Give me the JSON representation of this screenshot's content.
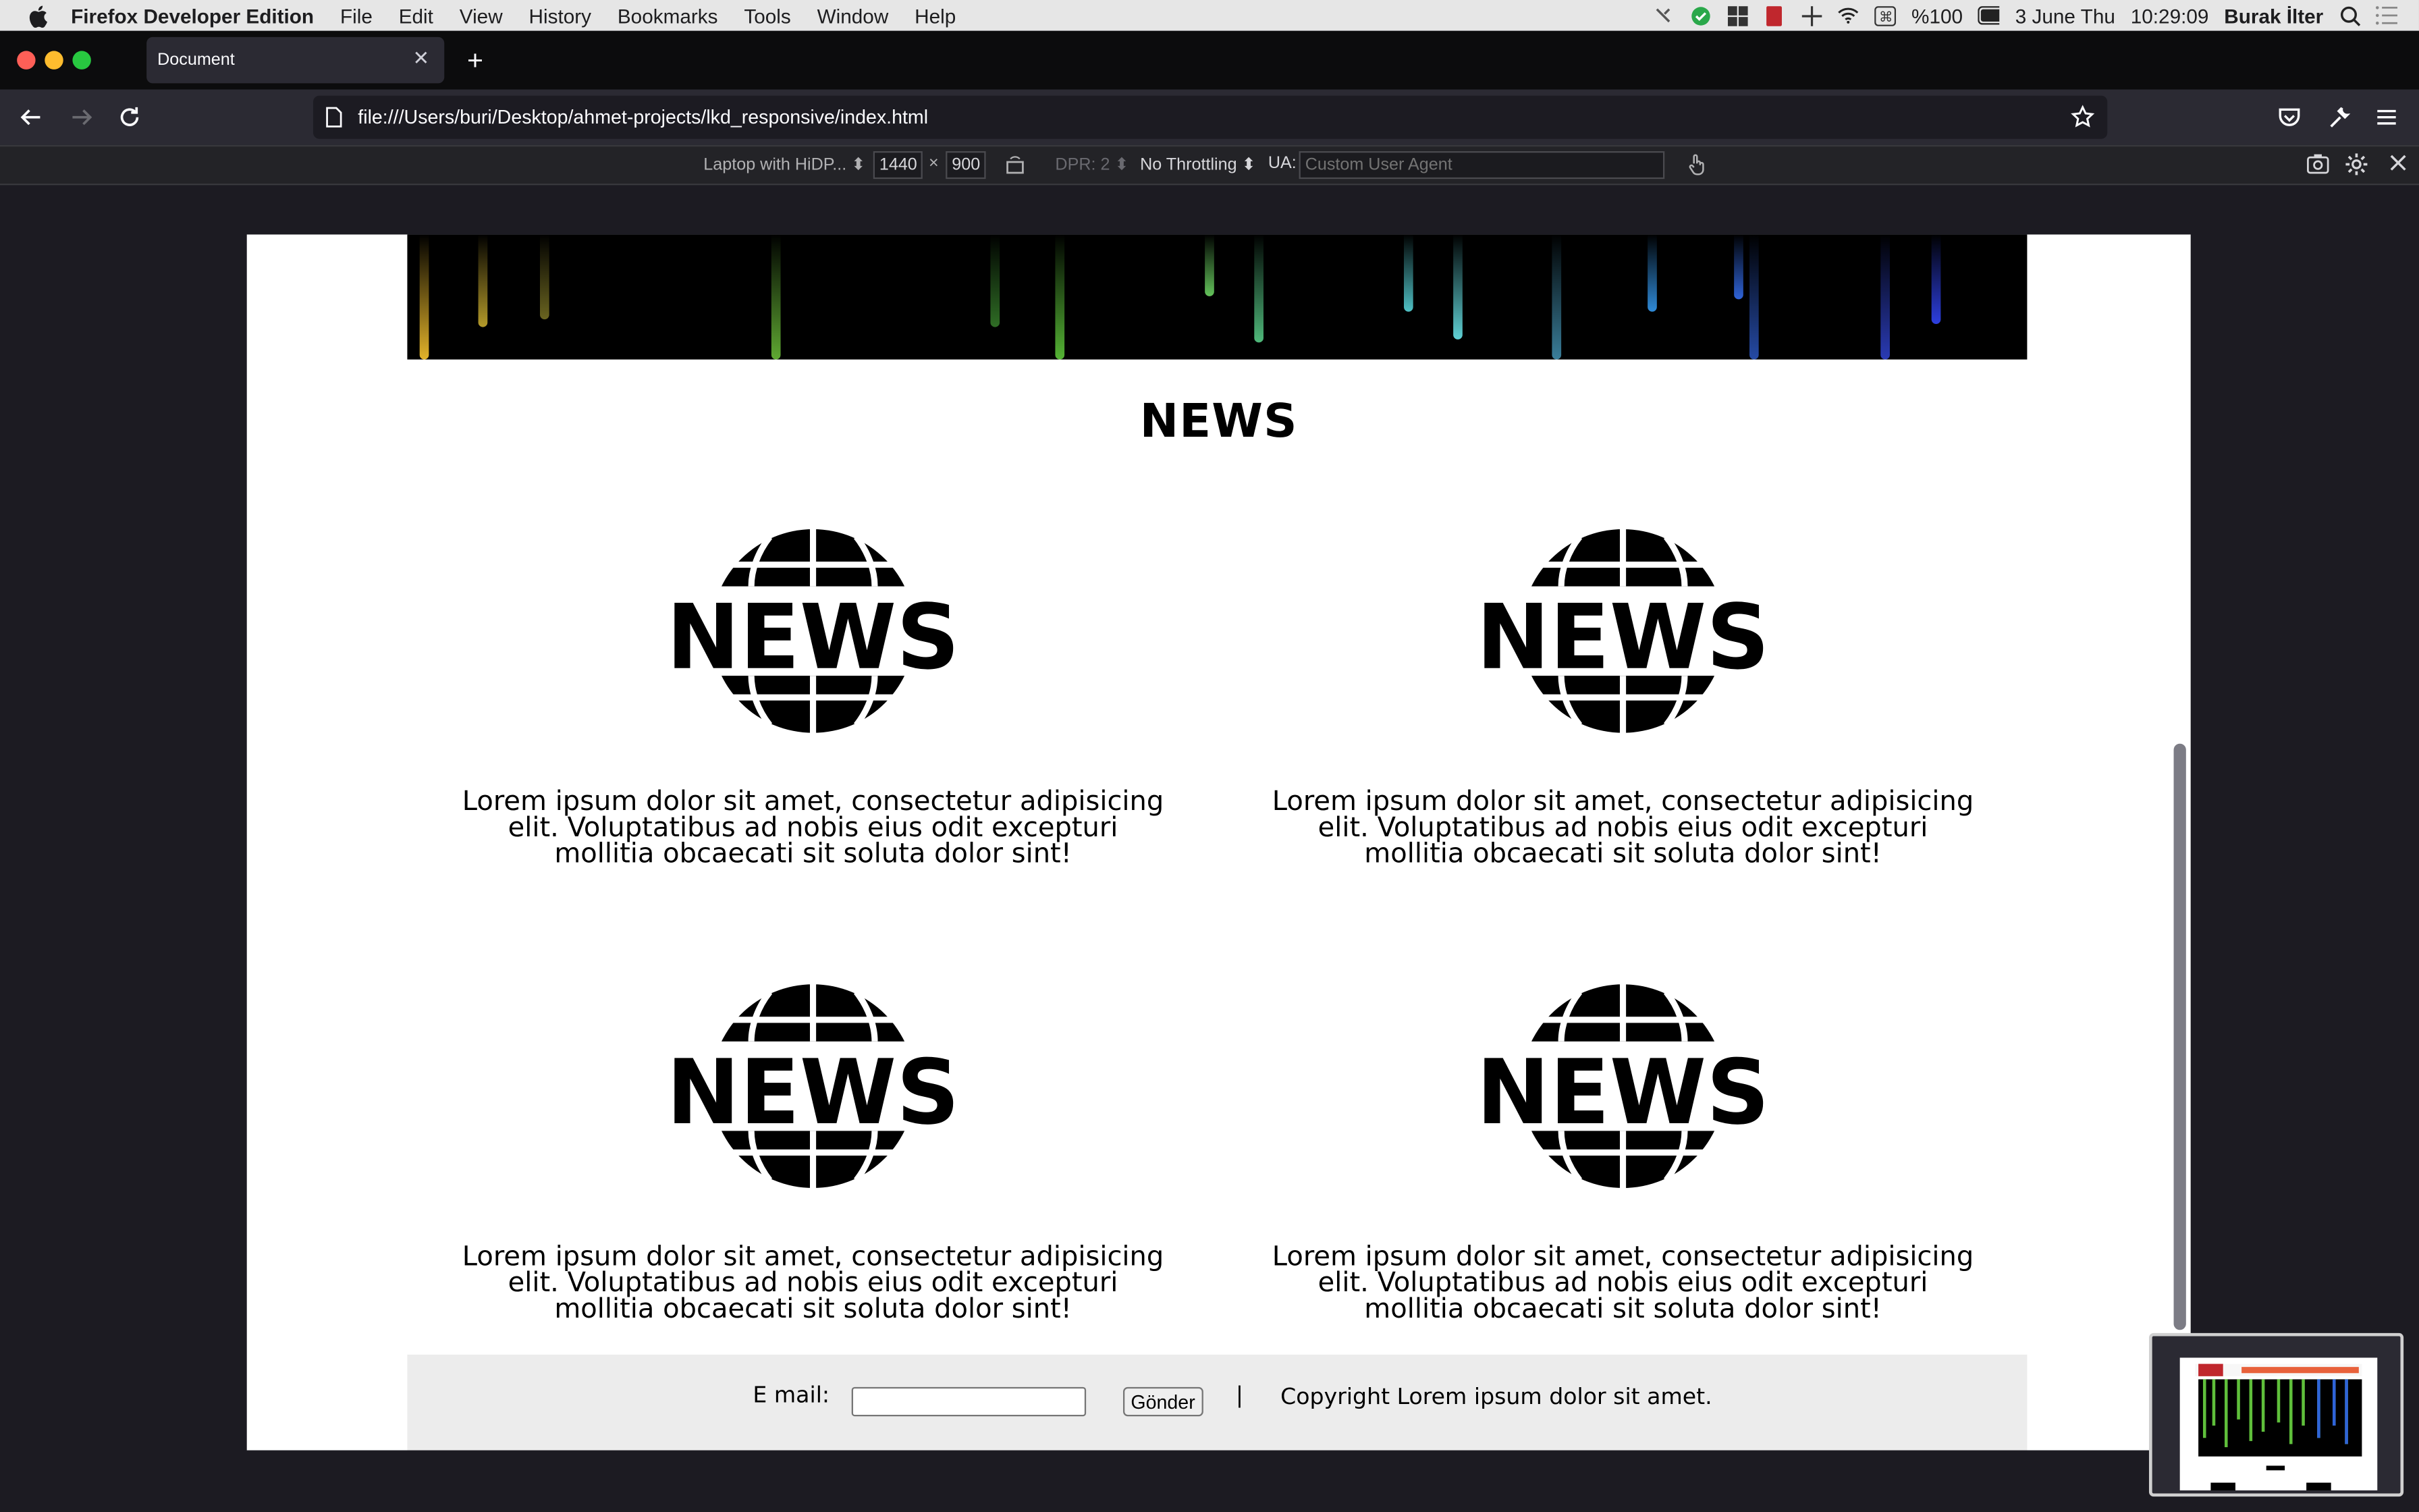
{
  "menubar": {
    "app_name": "Firefox Developer Edition",
    "menus": [
      "File",
      "Edit",
      "View",
      "History",
      "Bookmarks",
      "Tools",
      "Window",
      "Help"
    ],
    "battery": "%100",
    "date": "3 June Thu",
    "time": "10:29:09",
    "user": "Burak İlter"
  },
  "tab": {
    "title": "Document"
  },
  "navbar": {
    "url": "file:///Users/buri/Desktop/ahmet-projects/lkd_responsive/index.html"
  },
  "rdm": {
    "device": "Laptop with HiDP...",
    "width": "1440",
    "times": "×",
    "height": "900",
    "dpr": "DPR: 2",
    "throttling": "No Throttling",
    "ua_label": "UA:",
    "ua_placeholder": "Custom User Agent"
  },
  "page": {
    "title": "NEWS",
    "cards": [
      {
        "logo_text": "NEWS",
        "text": "Lorem ipsum dolor sit amet, consectetur adipisicing elit. Voluptatibus ad nobis eius odit excepturi mollitia obcaecati sit soluta dolor sint!"
      },
      {
        "logo_text": "NEWS",
        "text": "Lorem ipsum dolor sit amet, consectetur adipisicing elit. Voluptatibus ad nobis eius odit excepturi mollitia obcaecati sit soluta dolor sint!"
      },
      {
        "logo_text": "NEWS",
        "text": "Lorem ipsum dolor sit amet, consectetur adipisicing elit. Voluptatibus ad nobis eius odit excepturi mollitia obcaecati sit soluta dolor sint!"
      },
      {
        "logo_text": "NEWS",
        "text": "Lorem ipsum dolor sit amet, consectetur adipisicing elit. Voluptatibus ad nobis eius odit excepturi mollitia obcaecati sit soluta dolor sint!"
      }
    ],
    "footer": {
      "email_label": "E mail:",
      "submit_label": "Gönder",
      "separator": "|",
      "copyright": "Copyright Lorem ipsum dolor sit amet."
    }
  },
  "colors": {
    "menubar_bg": "#e6e6e6",
    "tabbar_bg": "#0c0c0d",
    "navbar_bg": "#2b2a33",
    "traffic_red": "#ff5f57",
    "traffic_yellow": "#febc2e",
    "traffic_green": "#28c840"
  },
  "icons": [
    "apple-icon",
    "back-icon",
    "forward-icon",
    "reload-icon",
    "page-icon",
    "bookmark-star-icon",
    "pocket-icon",
    "wrench-icon",
    "hamburger-menu-icon",
    "rotate-icon",
    "touch-icon",
    "screenshot-icon",
    "settings-icon",
    "close-icon",
    "globe-news-logo"
  ]
}
